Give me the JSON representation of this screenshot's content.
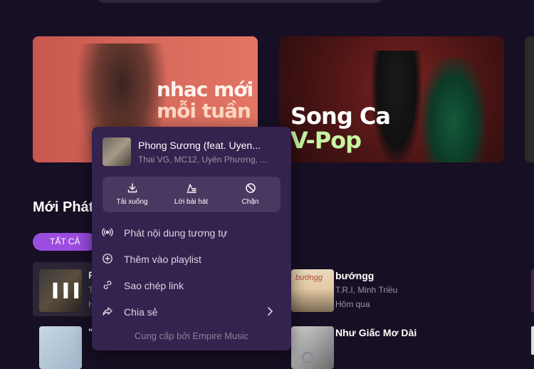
{
  "banners": [
    {
      "line1": "nhac mới",
      "line2": "mỗi tuần"
    },
    {
      "line1": "Song Ca",
      "line2": "V-Pop"
    }
  ],
  "section": {
    "title": "Mới Phát",
    "chip_active": "TẤT CẢ"
  },
  "rows": {
    "row1": {
      "title_peek": "P",
      "sub1_peek": "T",
      "sub2_peek": "H"
    },
    "row2": {
      "title_peek": "\""
    }
  },
  "songs": [
    {
      "title": "bướngg",
      "artists": "T.R.I, Minh Triều",
      "time": "Hôm qua",
      "cover_text": "bướngg"
    },
    {
      "title": "Như Giấc Mơ Dài",
      "artists": "",
      "time": ""
    }
  ],
  "context_menu": {
    "song_title": "Phong Sương (feat. Uyen...",
    "song_artists": "Thai VG, MC12, Uyên Phương, ...",
    "actions": [
      {
        "label": "Tải xuống",
        "icon": "download-icon"
      },
      {
        "label": "Lời bài hát",
        "icon": "lyrics-icon"
      },
      {
        "label": "Chặn",
        "icon": "block-icon"
      }
    ],
    "items": [
      {
        "label": "Phát nội dung tương tự",
        "icon": "radio-icon"
      },
      {
        "label": "Thêm vào playlist",
        "icon": "add-circle-icon"
      },
      {
        "label": "Sao chép link",
        "icon": "link-icon"
      },
      {
        "label": "Chia sẻ",
        "icon": "share-icon"
      }
    ],
    "footer": "Cung cấp bởi Empire Music"
  },
  "colors": {
    "background": "#170f23",
    "menu": "#34224f",
    "accent": "#9b4de0"
  }
}
